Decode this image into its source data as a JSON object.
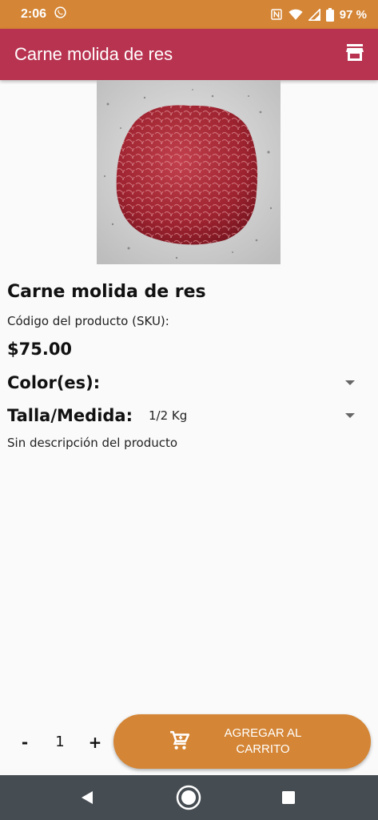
{
  "status_bar": {
    "time": "2:06",
    "battery": "97 %",
    "icons": [
      "whatsapp-icon",
      "nfc-icon",
      "wifi-icon",
      "signal-icon",
      "battery-icon"
    ]
  },
  "app_bar": {
    "title": "Carne molida de res",
    "action_icon": "store-icon"
  },
  "product": {
    "image_description": "raw ground beef",
    "name": "Carne molida de res",
    "sku_label": "Código del producto (SKU):",
    "price": "$75.00",
    "color_label": "Color(es):",
    "color_value": "",
    "size_label": "Talla/Medida:",
    "size_value": "1/2 Kg",
    "description": "Sin descripción del producto"
  },
  "cart": {
    "minus": "-",
    "quantity": "1",
    "plus": "+",
    "add_label": "AGREGAR AL CARRITO"
  },
  "colors": {
    "status_bar": "#d48535",
    "app_bar": "#b83350",
    "accent": "#d48535",
    "nav_bar": "#454c52"
  },
  "nav_bar": {
    "icons": [
      "back-icon",
      "home-icon",
      "recents-icon"
    ]
  }
}
